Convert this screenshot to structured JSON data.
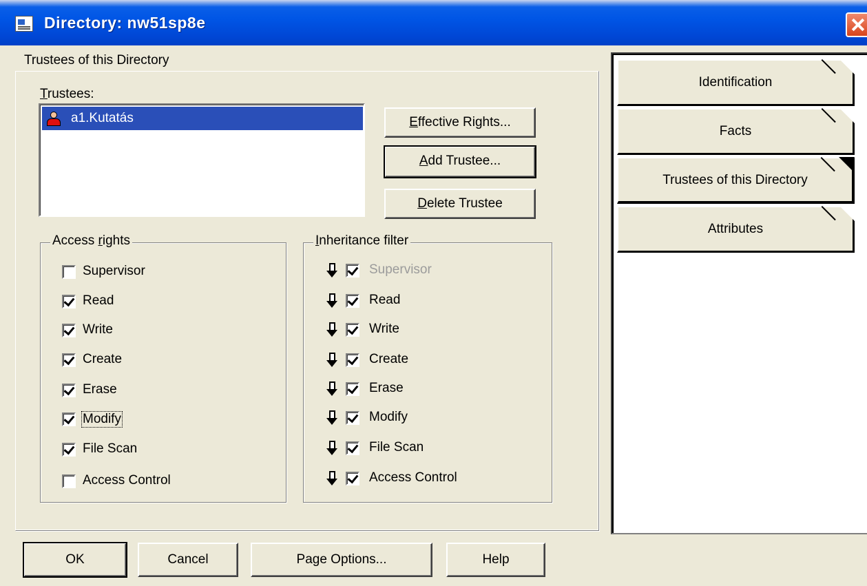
{
  "window": {
    "title": "Directory: nw51sp8e"
  },
  "panel": {
    "caption": "Trustees of this Directory",
    "trustees_label_first": "T",
    "trustees_label_rest": "rustees:",
    "trustees": [
      {
        "name": "a1.Kutatás",
        "selected": true,
        "icon": "user-icon"
      }
    ],
    "buttons": {
      "effective_rights_first": "E",
      "effective_rights_rest": "ffective Rights...",
      "add_trustee_first": "A",
      "add_trustee_rest": "dd Trustee...",
      "delete_trustee_first": "D",
      "delete_trustee_rest": "elete Trustee"
    },
    "access_rights": {
      "legend_before": "Access ",
      "legend_underlined": "r",
      "legend_after": "ights",
      "items": [
        {
          "label": "Supervisor",
          "checked": false
        },
        {
          "label": "Read",
          "checked": true
        },
        {
          "label": "Write",
          "checked": true
        },
        {
          "label": "Create",
          "checked": true
        },
        {
          "label": "Erase",
          "checked": true
        },
        {
          "label": "Modify",
          "checked": true,
          "focused": true
        },
        {
          "label": "File Scan",
          "checked": true
        },
        {
          "label": "Access Control",
          "checked": false
        }
      ]
    },
    "inheritance_filter": {
      "legend_underlined": "I",
      "legend_after": "nheritance filter",
      "items": [
        {
          "label": "Supervisor",
          "checked": true,
          "disabled": true
        },
        {
          "label": "Read",
          "checked": true
        },
        {
          "label": "Write",
          "checked": true
        },
        {
          "label": "Create",
          "checked": true
        },
        {
          "label": "Erase",
          "checked": true
        },
        {
          "label": "Modify",
          "checked": true
        },
        {
          "label": "File Scan",
          "checked": true
        },
        {
          "label": "Access Control",
          "checked": true
        }
      ]
    }
  },
  "pages": [
    {
      "label": "Identification",
      "active": false
    },
    {
      "label": "Facts",
      "active": false
    },
    {
      "label": "Trustees of this Directory",
      "active": true
    },
    {
      "label": "Attributes",
      "active": false
    }
  ],
  "footer": {
    "ok": "OK",
    "cancel": "Cancel",
    "page_options": "Page Options...",
    "help": "Help"
  },
  "colors": {
    "dialog_bg": "#ece9d8",
    "title_bar": "#0055e5",
    "selection": "#2a4fb8"
  }
}
